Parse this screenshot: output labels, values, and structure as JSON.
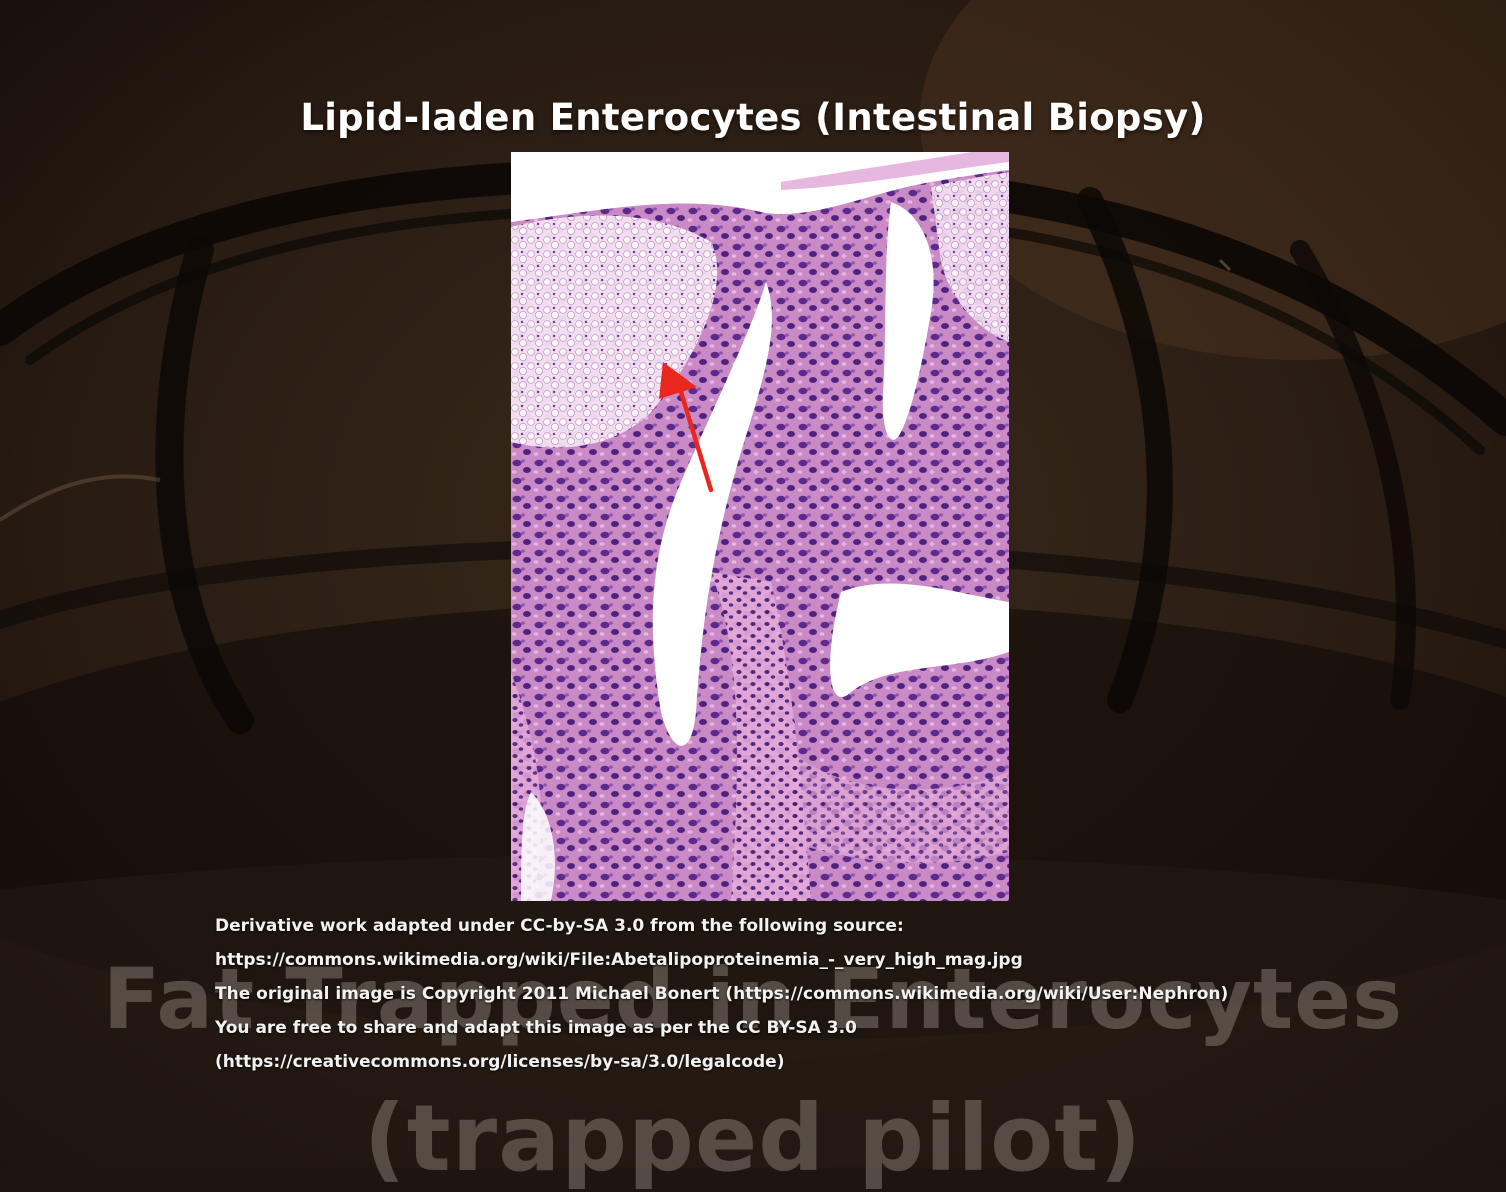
{
  "slide": {
    "title": "Lipid-laden Enterocytes (Intestinal Biopsy)"
  },
  "background": {
    "watermark_line1": "Fat Trapped in Enterocytes",
    "watermark_line2": "(trapped pilot)"
  },
  "image": {
    "subject": "H&E stained intestinal biopsy, very high magnification",
    "annotation": "red arrow"
  },
  "credits": {
    "line1": "Derivative work adapted under CC-by-SA 3.0 from the following source:",
    "line2": "https://commons.wikimedia.org/wiki/File:Abetalipoproteinemia_-_very_high_mag.jpg",
    "line3": "The original image is Copyright 2011 Michael Bonert (https://commons.wikimedia.org/wiki/User:Nephron)",
    "line4": "You are free to share and adapt this image as per the CC BY-SA 3.0",
    "line5": "(https://creativecommons.org/licenses/by-sa/3.0/legalcode)"
  },
  "colors": {
    "background": "#1e1510",
    "title_text": "#ffffff",
    "arrow": "#e8281e",
    "tissue_pink": "#e7a6d8",
    "nuclei_purple": "#5b2a8c"
  }
}
